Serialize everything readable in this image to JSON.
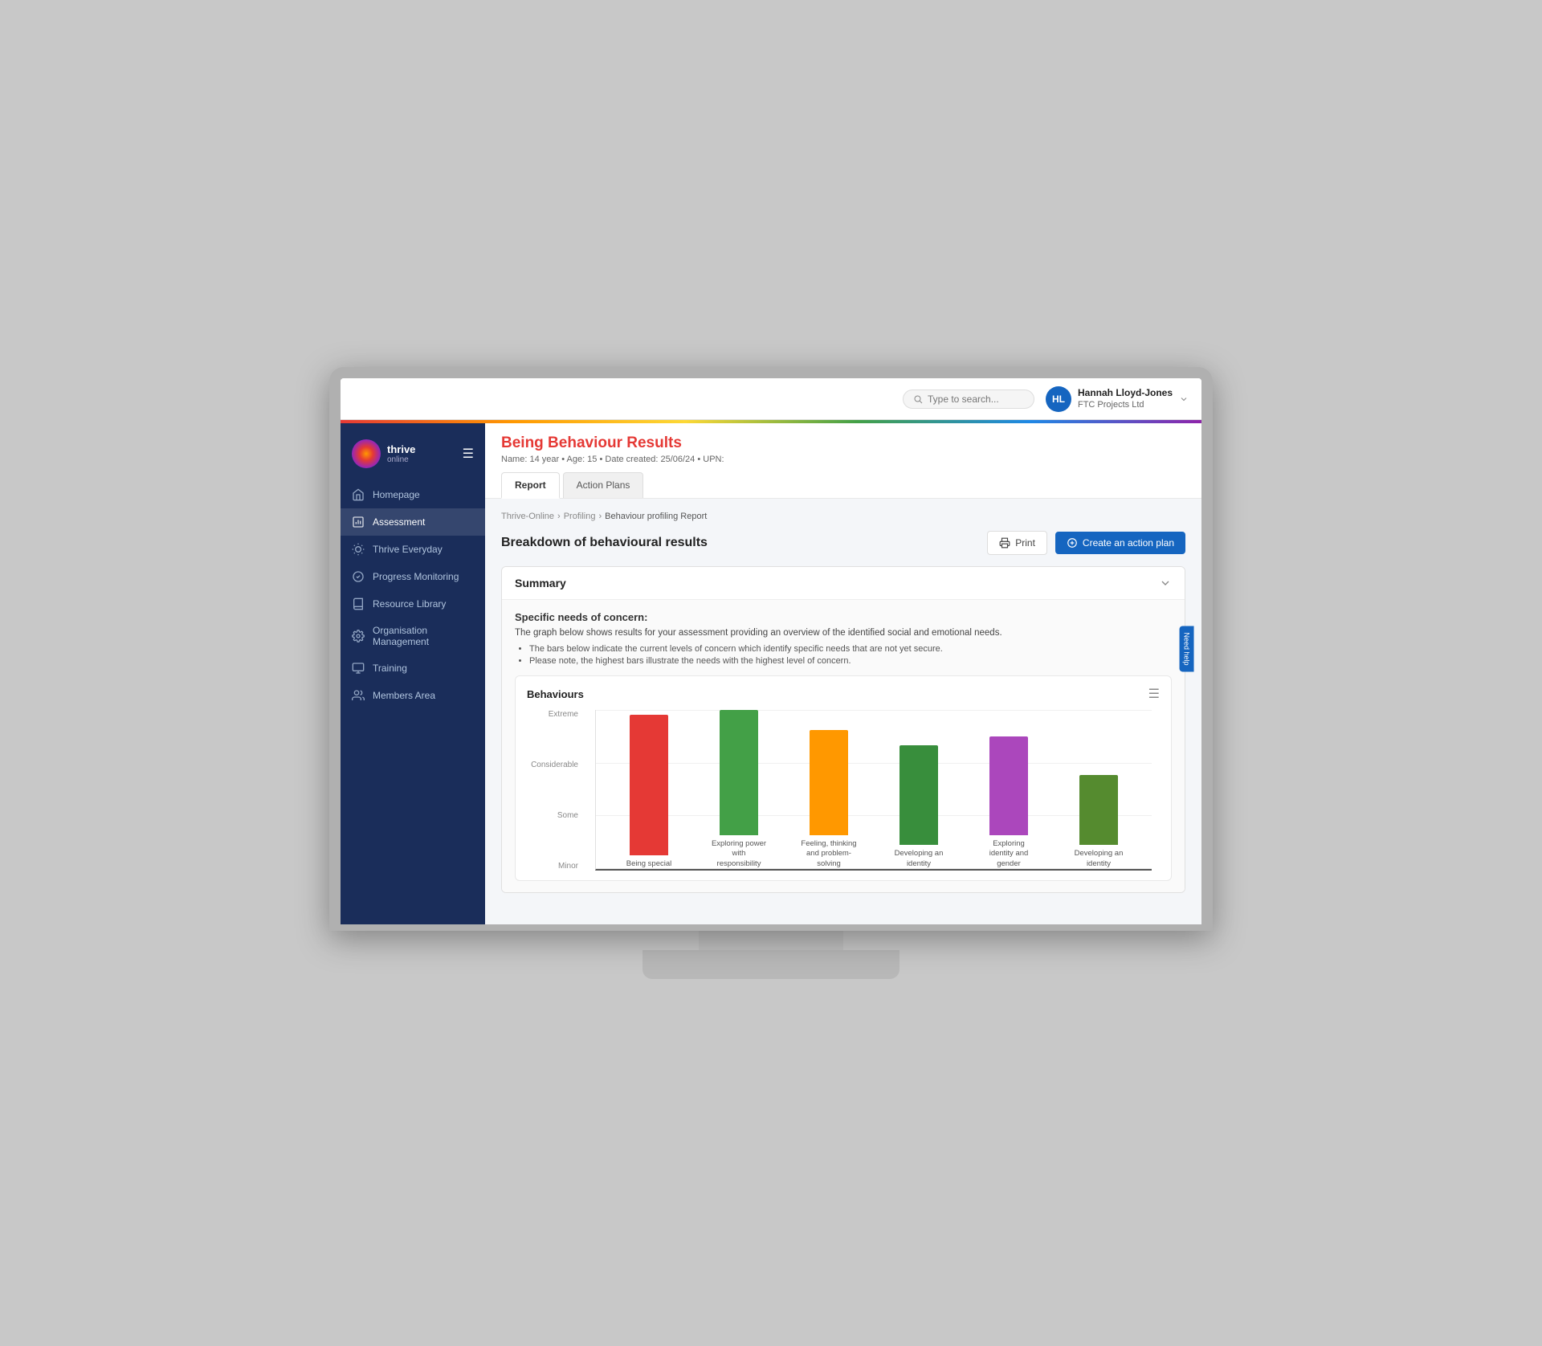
{
  "app": {
    "title": "Thrive Online"
  },
  "topbar": {
    "search_placeholder": "Type to search...",
    "user_name": "Hannah Lloyd-Jones",
    "user_company": "FTC Projects Ltd",
    "user_initials": "HL"
  },
  "sidebar": {
    "logo_text": "thrive",
    "logo_sub": "online",
    "nav_items": [
      {
        "id": "homepage",
        "label": "Homepage",
        "icon": "home"
      },
      {
        "id": "assessment",
        "label": "Assessment",
        "icon": "chart",
        "active": true
      },
      {
        "id": "thrive-everyday",
        "label": "Thrive Everyday",
        "icon": "sun"
      },
      {
        "id": "progress-monitoring",
        "label": "Progress Monitoring",
        "icon": "circle-check"
      },
      {
        "id": "resource-library",
        "label": "Resource Library",
        "icon": "book"
      },
      {
        "id": "organisation-management",
        "label": "Organisation Management",
        "icon": "settings"
      },
      {
        "id": "training",
        "label": "Training",
        "icon": "monitor"
      },
      {
        "id": "members-area",
        "label": "Members Area",
        "icon": "users"
      }
    ]
  },
  "page": {
    "title": "Being Behaviour Results",
    "meta": "Name: 14 year  •  Age: 15  •  Date created: 25/06/24  •  UPN:",
    "tabs": [
      {
        "id": "report",
        "label": "Report",
        "active": true
      },
      {
        "id": "action-plans",
        "label": "Action Plans",
        "active": false
      }
    ],
    "breadcrumb": {
      "items": [
        "Thrive-Online",
        "Profiling",
        "Behaviour profiling Report"
      ]
    },
    "section_title": "Breakdown of behavioural results",
    "print_label": "Print",
    "create_action_plan_label": "Create an action plan"
  },
  "summary": {
    "title": "Summary",
    "needs_title": "Specific needs of concern:",
    "description": "The graph below shows results for your assessment providing an overview of the identified social and emotional needs.",
    "bullets": [
      "The bars below indicate the current levels of concern which identify specific needs that are not yet secure.",
      "Please note, the highest bars illustrate the needs with the highest level of concern."
    ]
  },
  "chart": {
    "title": "Behaviours",
    "y_labels": [
      "Extreme",
      "Considerable",
      "Some",
      "Minor"
    ],
    "bars": [
      {
        "label": "Being special",
        "color": "#e53935",
        "height_pct": 88
      },
      {
        "label": "Exploring power with responsibility",
        "color": "#43a047",
        "height_pct": 90
      },
      {
        "label": "Feeling, thinking and problem-solving",
        "color": "#ff9800",
        "height_pct": 66
      },
      {
        "label": "Developing an identity",
        "color": "#388e3c",
        "height_pct": 63
      },
      {
        "label": "Exploring identity and gender",
        "color": "#ab47bc",
        "height_pct": 62
      },
      {
        "label": "Developing an identity",
        "color": "#558b2f",
        "height_pct": 44
      }
    ]
  },
  "need_help": "Need help"
}
